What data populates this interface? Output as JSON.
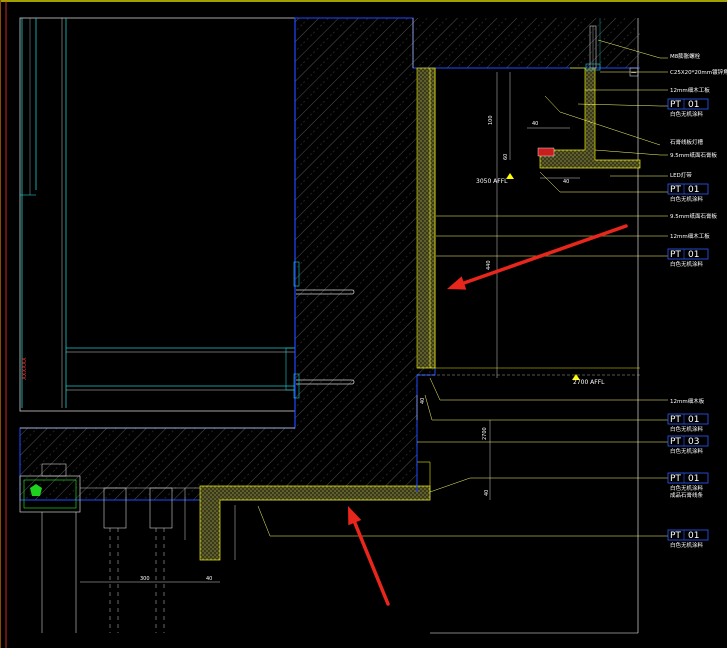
{
  "drawing": {
    "colors": {
      "background": "#000000",
      "border": "#ffff00",
      "frame": "#ff3030",
      "wall": "#1e4bff",
      "hatch": "#d8d8d8",
      "board": "#e8e800",
      "leader": "#ffff66",
      "dimension": "#00ffff",
      "tag_box": "#2a5bff",
      "arrow": "#e8261c",
      "glazing": "#1fd11f"
    },
    "labels": [
      {
        "text": "M8膨胀螺栓"
      },
      {
        "text": "C25X20*20mm镀锌角钢",
        "badge": "一"
      },
      {
        "text": "12mm细木工板"
      },
      {
        "code": "PT",
        "num": "01",
        "sub": "白色无机涂料"
      },
      {
        "text": "石膏线板灯槽"
      },
      {
        "text": "9.5mm纸面石膏板"
      },
      {
        "text": "LED灯带"
      },
      {
        "code": "PT",
        "num": "01",
        "sub": "白色无机涂料"
      },
      {
        "text": "9.5mm纸面石膏板"
      },
      {
        "text": "12mm细木工板"
      },
      {
        "code": "PT",
        "num": "01",
        "sub": "白色无机涂料"
      },
      {
        "text": "12mm细木板"
      },
      {
        "code": "PT",
        "num": "01",
        "sub": "白色无机涂料"
      },
      {
        "code": "PT",
        "num": "03",
        "sub": "白色无机涂料"
      },
      {
        "code": "PT",
        "num": "01",
        "sub": "白色无机涂料",
        "sub2": "成品石膏线条"
      },
      {
        "code": "PT",
        "num": "01",
        "sub": "白色无机涂料"
      }
    ],
    "levels": [
      {
        "text": "3050 AFFL"
      },
      {
        "text": "2700 AFFL"
      }
    ],
    "dimensions": [
      {
        "text": "100"
      },
      {
        "text": "40"
      },
      {
        "text": "60"
      },
      {
        "text": "40"
      },
      {
        "text": "440"
      },
      {
        "text": "40"
      },
      {
        "text": "2700"
      },
      {
        "text": "40"
      },
      {
        "text": "300"
      },
      {
        "text": "40"
      }
    ],
    "annotations": [
      {
        "kind": "arrow",
        "target": "wall-board-upper"
      },
      {
        "kind": "arrow",
        "target": "sill-board-lower"
      }
    ]
  }
}
